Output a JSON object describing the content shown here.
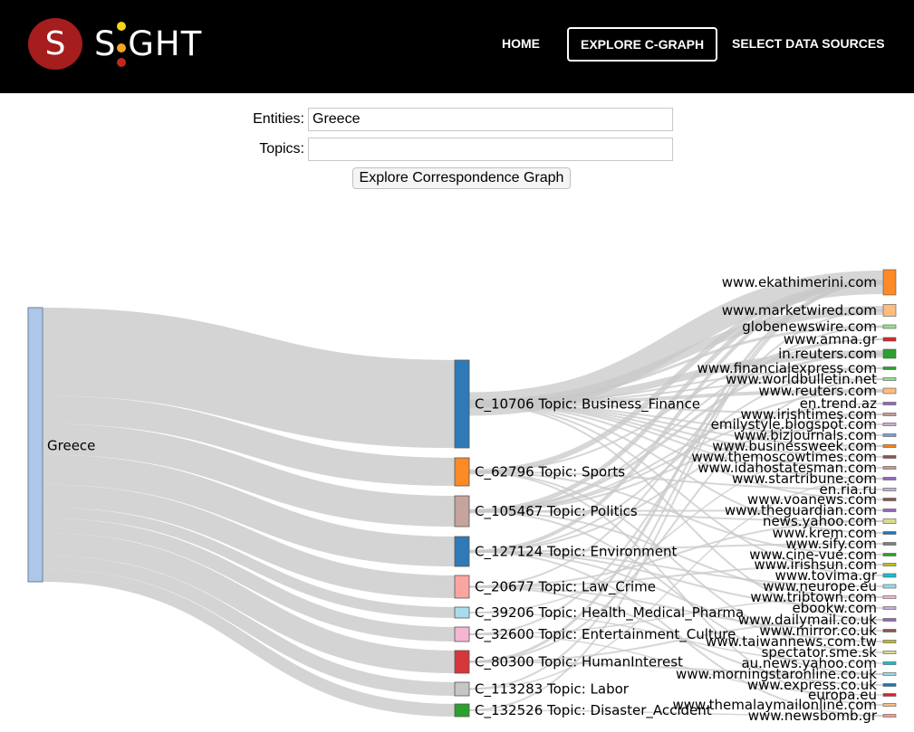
{
  "header": {
    "logo_letter": "S",
    "logo_text": "S GHT",
    "nav": [
      {
        "label": "HOME",
        "active": false
      },
      {
        "label": "EXPLORE C-GRAPH",
        "active": true
      },
      {
        "label": "SELECT DATA SOURCES",
        "active": false
      }
    ]
  },
  "form": {
    "entities_label": "Entities:",
    "entities_value": "Greece",
    "topics_label": "Topics:",
    "topics_value": "",
    "button_label": "Explore Correspondence Graph"
  },
  "graph": {
    "source": "Greece",
    "topics": [
      {
        "label": "C_10706 Topic: Business_Finance",
        "color": "#2f7ab6"
      },
      {
        "label": "C_62796 Topic: Sports",
        "color": "#fb8a27"
      },
      {
        "label": "C_105467 Topic: Politics",
        "color": "#c6a39c"
      },
      {
        "label": "C_127124 Topic: Environment",
        "color": "#2f7ab6"
      },
      {
        "label": "C_20677 Topic: Law_Crime",
        "color": "#fba5a3"
      },
      {
        "label": "C_39206 Topic: Health_Medical_Pharma",
        "color": "#a9dcea"
      },
      {
        "label": "C_32600 Topic: Entertainment_Culture",
        "color": "#f5b6d3"
      },
      {
        "label": "C_80300 Topic: HumanInterest",
        "color": "#d6373a"
      },
      {
        "label": "C_113283 Topic: Labor",
        "color": "#c6c6c6"
      },
      {
        "label": "C_132526 Topic: Disaster_Accident",
        "color": "#2ca02c"
      }
    ],
    "sites": [
      {
        "label": "www.ekathimerini.com",
        "color": "#fb8a27"
      },
      {
        "label": "www.marketwired.com",
        "color": "#fdbd7e"
      },
      {
        "label": "globenewswire.com",
        "color": "#98df8a"
      },
      {
        "label": "www.amna.gr",
        "color": "#d62728"
      },
      {
        "label": "in.reuters.com",
        "color": "#2ca02c"
      },
      {
        "label": "www.financialexpress.com",
        "color": "#2ca02c"
      },
      {
        "label": "www.worldbulletin.net",
        "color": "#98df8a"
      },
      {
        "label": "www.reuters.com",
        "color": "#fdbd7e"
      },
      {
        "label": "en.trend.az",
        "color": "#9467bd"
      },
      {
        "label": "www.irishtimes.com",
        "color": "#c49c94"
      },
      {
        "label": "emilystyle.blogspot.com",
        "color": "#c5b0d5"
      },
      {
        "label": "www.bizjournals.com",
        "color": "#7f9fd0"
      },
      {
        "label": "www.businessweek.com",
        "color": "#ff7f0e"
      },
      {
        "label": "www.themoscowtimes.com",
        "color": "#8c564b"
      },
      {
        "label": "www.idahostatesman.com",
        "color": "#c49c94"
      },
      {
        "label": "www.startribune.com",
        "color": "#9467bd"
      },
      {
        "label": "en.ria.ru",
        "color": "#c5b0d5"
      },
      {
        "label": "www.voanews.com",
        "color": "#8c564b"
      },
      {
        "label": "www.theguardian.com",
        "color": "#9467bd"
      },
      {
        "label": "news.yahoo.com",
        "color": "#dbdb8d"
      },
      {
        "label": "www.krem.com",
        "color": "#1f77b4"
      },
      {
        "label": "www.sify.com",
        "color": "#7f7f7f"
      },
      {
        "label": "www.cine-vue.com",
        "color": "#2ca02c"
      },
      {
        "label": "www.irishsun.com",
        "color": "#bcbd22"
      },
      {
        "label": "www.tovima.gr",
        "color": "#17becf"
      },
      {
        "label": "www.neurope.eu",
        "color": "#9edae5"
      },
      {
        "label": "www.tribtown.com",
        "color": "#f7b6d2"
      },
      {
        "label": "ebookw.com",
        "color": "#c5b0d5"
      },
      {
        "label": "www.dailymail.co.uk",
        "color": "#9467bd"
      },
      {
        "label": "www.mirror.co.uk",
        "color": "#8c564b"
      },
      {
        "label": "www.taiwannews.com.tw",
        "color": "#bcbd22"
      },
      {
        "label": "spectator.sme.sk",
        "color": "#dbdb8d"
      },
      {
        "label": "au.news.yahoo.com",
        "color": "#17becf"
      },
      {
        "label": "www.morningstaronline.co.uk",
        "color": "#9edae5"
      },
      {
        "label": "www.express.co.uk",
        "color": "#1f77b4"
      },
      {
        "label": "europa.eu",
        "color": "#d62728"
      },
      {
        "label": "www.themalaymailonline.com",
        "color": "#fdbd7e"
      },
      {
        "label": "www.newsbomb.gr",
        "color": "#ff9896"
      }
    ]
  }
}
